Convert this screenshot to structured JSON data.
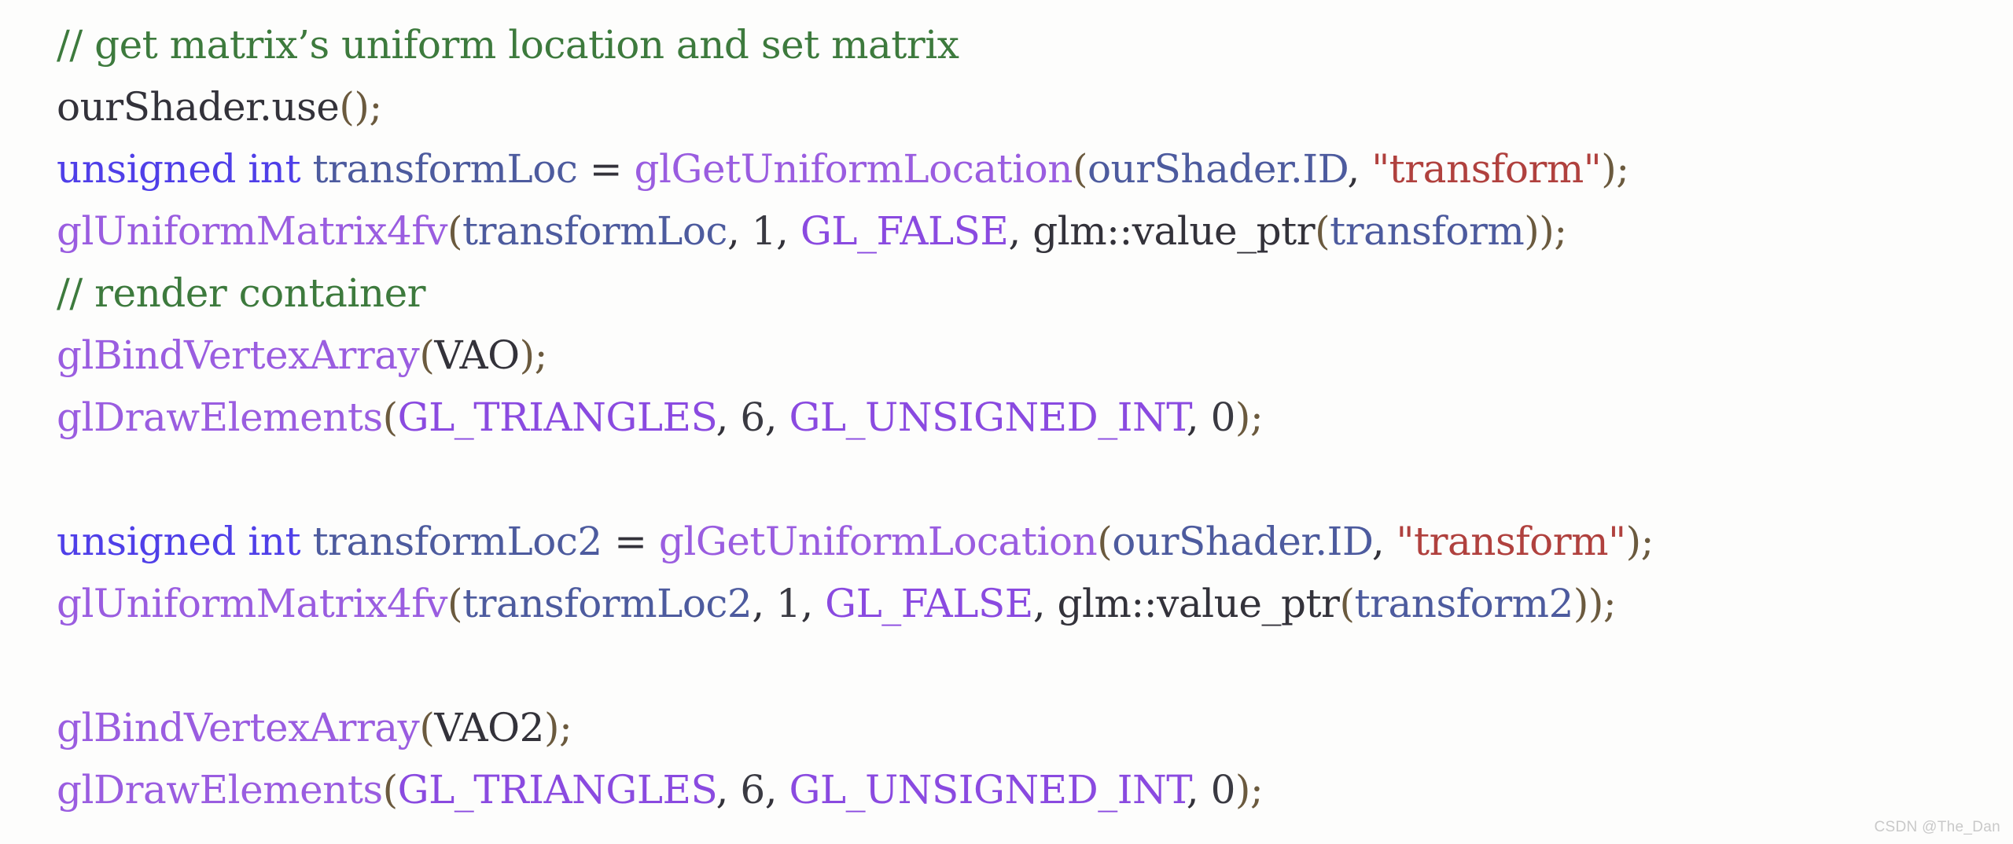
{
  "editor": {
    "background_color": "#fdfdfc",
    "language": "cpp",
    "font_size_px": 50
  },
  "palette": {
    "comment": "#3d7a3d",
    "plain": "#33323a",
    "keyword": "#4f3fe8",
    "variable": "#4d5b9e",
    "function": "#9a5de0",
    "constant": "#8a4ae0",
    "string": "#b0413e",
    "number": "#3a3a42",
    "punctuation": "#6b5a3e",
    "watermark": "#c9c9c9"
  },
  "code": {
    "lines": [
      {
        "index": 1,
        "text": "// get matrix's uniform location and set matrix",
        "tokens": [
          {
            "t": "// get matrix’s uniform location and set matrix",
            "c": "comment"
          }
        ]
      },
      {
        "index": 2,
        "text": "ourShader.use();",
        "tokens": [
          {
            "t": "ourShader.use",
            "c": "plain"
          },
          {
            "t": "();",
            "c": "punct"
          }
        ]
      },
      {
        "index": 3,
        "text": "unsigned int transformLoc = glGetUniformLocation(ourShader.ID, \"transform\");",
        "tokens": [
          {
            "t": "unsigned int",
            "c": "keyword"
          },
          {
            "t": " ",
            "c": "plain"
          },
          {
            "t": "transformLoc",
            "c": "var"
          },
          {
            "t": " = ",
            "c": "plain"
          },
          {
            "t": "glGetUniformLocation",
            "c": "func"
          },
          {
            "t": "(",
            "c": "punct"
          },
          {
            "t": "ourShader.ID",
            "c": "var"
          },
          {
            "t": ", ",
            "c": "plain"
          },
          {
            "t": "\"transform\"",
            "c": "string"
          },
          {
            "t": ");",
            "c": "punct"
          }
        ]
      },
      {
        "index": 4,
        "text": "glUniformMatrix4fv(transformLoc, 1, GL_FALSE, glm::value_ptr(transform));",
        "tokens": [
          {
            "t": "glUniformMatrix4fv",
            "c": "func"
          },
          {
            "t": "(",
            "c": "punct"
          },
          {
            "t": "transformLoc",
            "c": "var"
          },
          {
            "t": ", ",
            "c": "plain"
          },
          {
            "t": "1",
            "c": "number"
          },
          {
            "t": ", ",
            "c": "plain"
          },
          {
            "t": "GL_FALSE",
            "c": "const"
          },
          {
            "t": ", ",
            "c": "plain"
          },
          {
            "t": "glm::value_ptr",
            "c": "plain"
          },
          {
            "t": "(",
            "c": "punct"
          },
          {
            "t": "transform",
            "c": "var"
          },
          {
            "t": "));",
            "c": "punct"
          }
        ]
      },
      {
        "index": 5,
        "text": "// render container",
        "tokens": [
          {
            "t": "// render container",
            "c": "comment"
          }
        ]
      },
      {
        "index": 6,
        "text": "glBindVertexArray(VAO);",
        "tokens": [
          {
            "t": "glBindVertexArray",
            "c": "func"
          },
          {
            "t": "(",
            "c": "punct"
          },
          {
            "t": "VAO",
            "c": "plain"
          },
          {
            "t": ");",
            "c": "punct"
          }
        ]
      },
      {
        "index": 7,
        "text": "glDrawElements(GL_TRIANGLES, 6, GL_UNSIGNED_INT, 0);",
        "tokens": [
          {
            "t": "glDrawElements",
            "c": "func"
          },
          {
            "t": "(",
            "c": "punct"
          },
          {
            "t": "GL_TRIANGLES",
            "c": "const"
          },
          {
            "t": ", ",
            "c": "plain"
          },
          {
            "t": "6",
            "c": "number"
          },
          {
            "t": ", ",
            "c": "plain"
          },
          {
            "t": "GL_UNSIGNED_INT",
            "c": "const"
          },
          {
            "t": ", ",
            "c": "plain"
          },
          {
            "t": "0",
            "c": "number"
          },
          {
            "t": ");",
            "c": "punct"
          }
        ]
      },
      {
        "index": 8,
        "text": "",
        "tokens": []
      },
      {
        "index": 9,
        "text": "unsigned int transformLoc2 = glGetUniformLocation(ourShader.ID, \"transform\");",
        "tokens": [
          {
            "t": "unsigned int",
            "c": "keyword"
          },
          {
            "t": " ",
            "c": "plain"
          },
          {
            "t": "transformLoc2",
            "c": "var"
          },
          {
            "t": " = ",
            "c": "plain"
          },
          {
            "t": "glGetUniformLocation",
            "c": "func"
          },
          {
            "t": "(",
            "c": "punct"
          },
          {
            "t": "ourShader.ID",
            "c": "var"
          },
          {
            "t": ", ",
            "c": "plain"
          },
          {
            "t": "\"transform\"",
            "c": "string"
          },
          {
            "t": ");",
            "c": "punct"
          }
        ]
      },
      {
        "index": 10,
        "text": "glUniformMatrix4fv(transformLoc2, 1, GL_FALSE, glm::value_ptr(transform2));",
        "tokens": [
          {
            "t": "glUniformMatrix4fv",
            "c": "func"
          },
          {
            "t": "(",
            "c": "punct"
          },
          {
            "t": "transformLoc2",
            "c": "var"
          },
          {
            "t": ", ",
            "c": "plain"
          },
          {
            "t": "1",
            "c": "number"
          },
          {
            "t": ", ",
            "c": "plain"
          },
          {
            "t": "GL_FALSE",
            "c": "const"
          },
          {
            "t": ", ",
            "c": "plain"
          },
          {
            "t": "glm::value_ptr",
            "c": "plain"
          },
          {
            "t": "(",
            "c": "punct"
          },
          {
            "t": "transform2",
            "c": "var"
          },
          {
            "t": "));",
            "c": "punct"
          }
        ]
      },
      {
        "index": 11,
        "text": "",
        "tokens": []
      },
      {
        "index": 12,
        "text": "glBindVertexArray(VAO2);",
        "tokens": [
          {
            "t": "glBindVertexArray",
            "c": "func"
          },
          {
            "t": "(",
            "c": "punct"
          },
          {
            "t": "VAO2",
            "c": "plain"
          },
          {
            "t": ");",
            "c": "punct"
          }
        ]
      },
      {
        "index": 13,
        "text": "glDrawElements(GL_TRIANGLES, 6, GL_UNSIGNED_INT, 0);",
        "tokens": [
          {
            "t": "glDrawElements",
            "c": "func"
          },
          {
            "t": "(",
            "c": "punct"
          },
          {
            "t": "GL_TRIANGLES",
            "c": "const"
          },
          {
            "t": ", ",
            "c": "plain"
          },
          {
            "t": "6",
            "c": "number"
          },
          {
            "t": ", ",
            "c": "plain"
          },
          {
            "t": "GL_UNSIGNED_INT",
            "c": "const"
          },
          {
            "t": ", ",
            "c": "plain"
          },
          {
            "t": "0",
            "c": "number"
          },
          {
            "t": ");",
            "c": "punct"
          }
        ]
      }
    ]
  },
  "watermark": {
    "text": "CSDN @The_Dan"
  }
}
